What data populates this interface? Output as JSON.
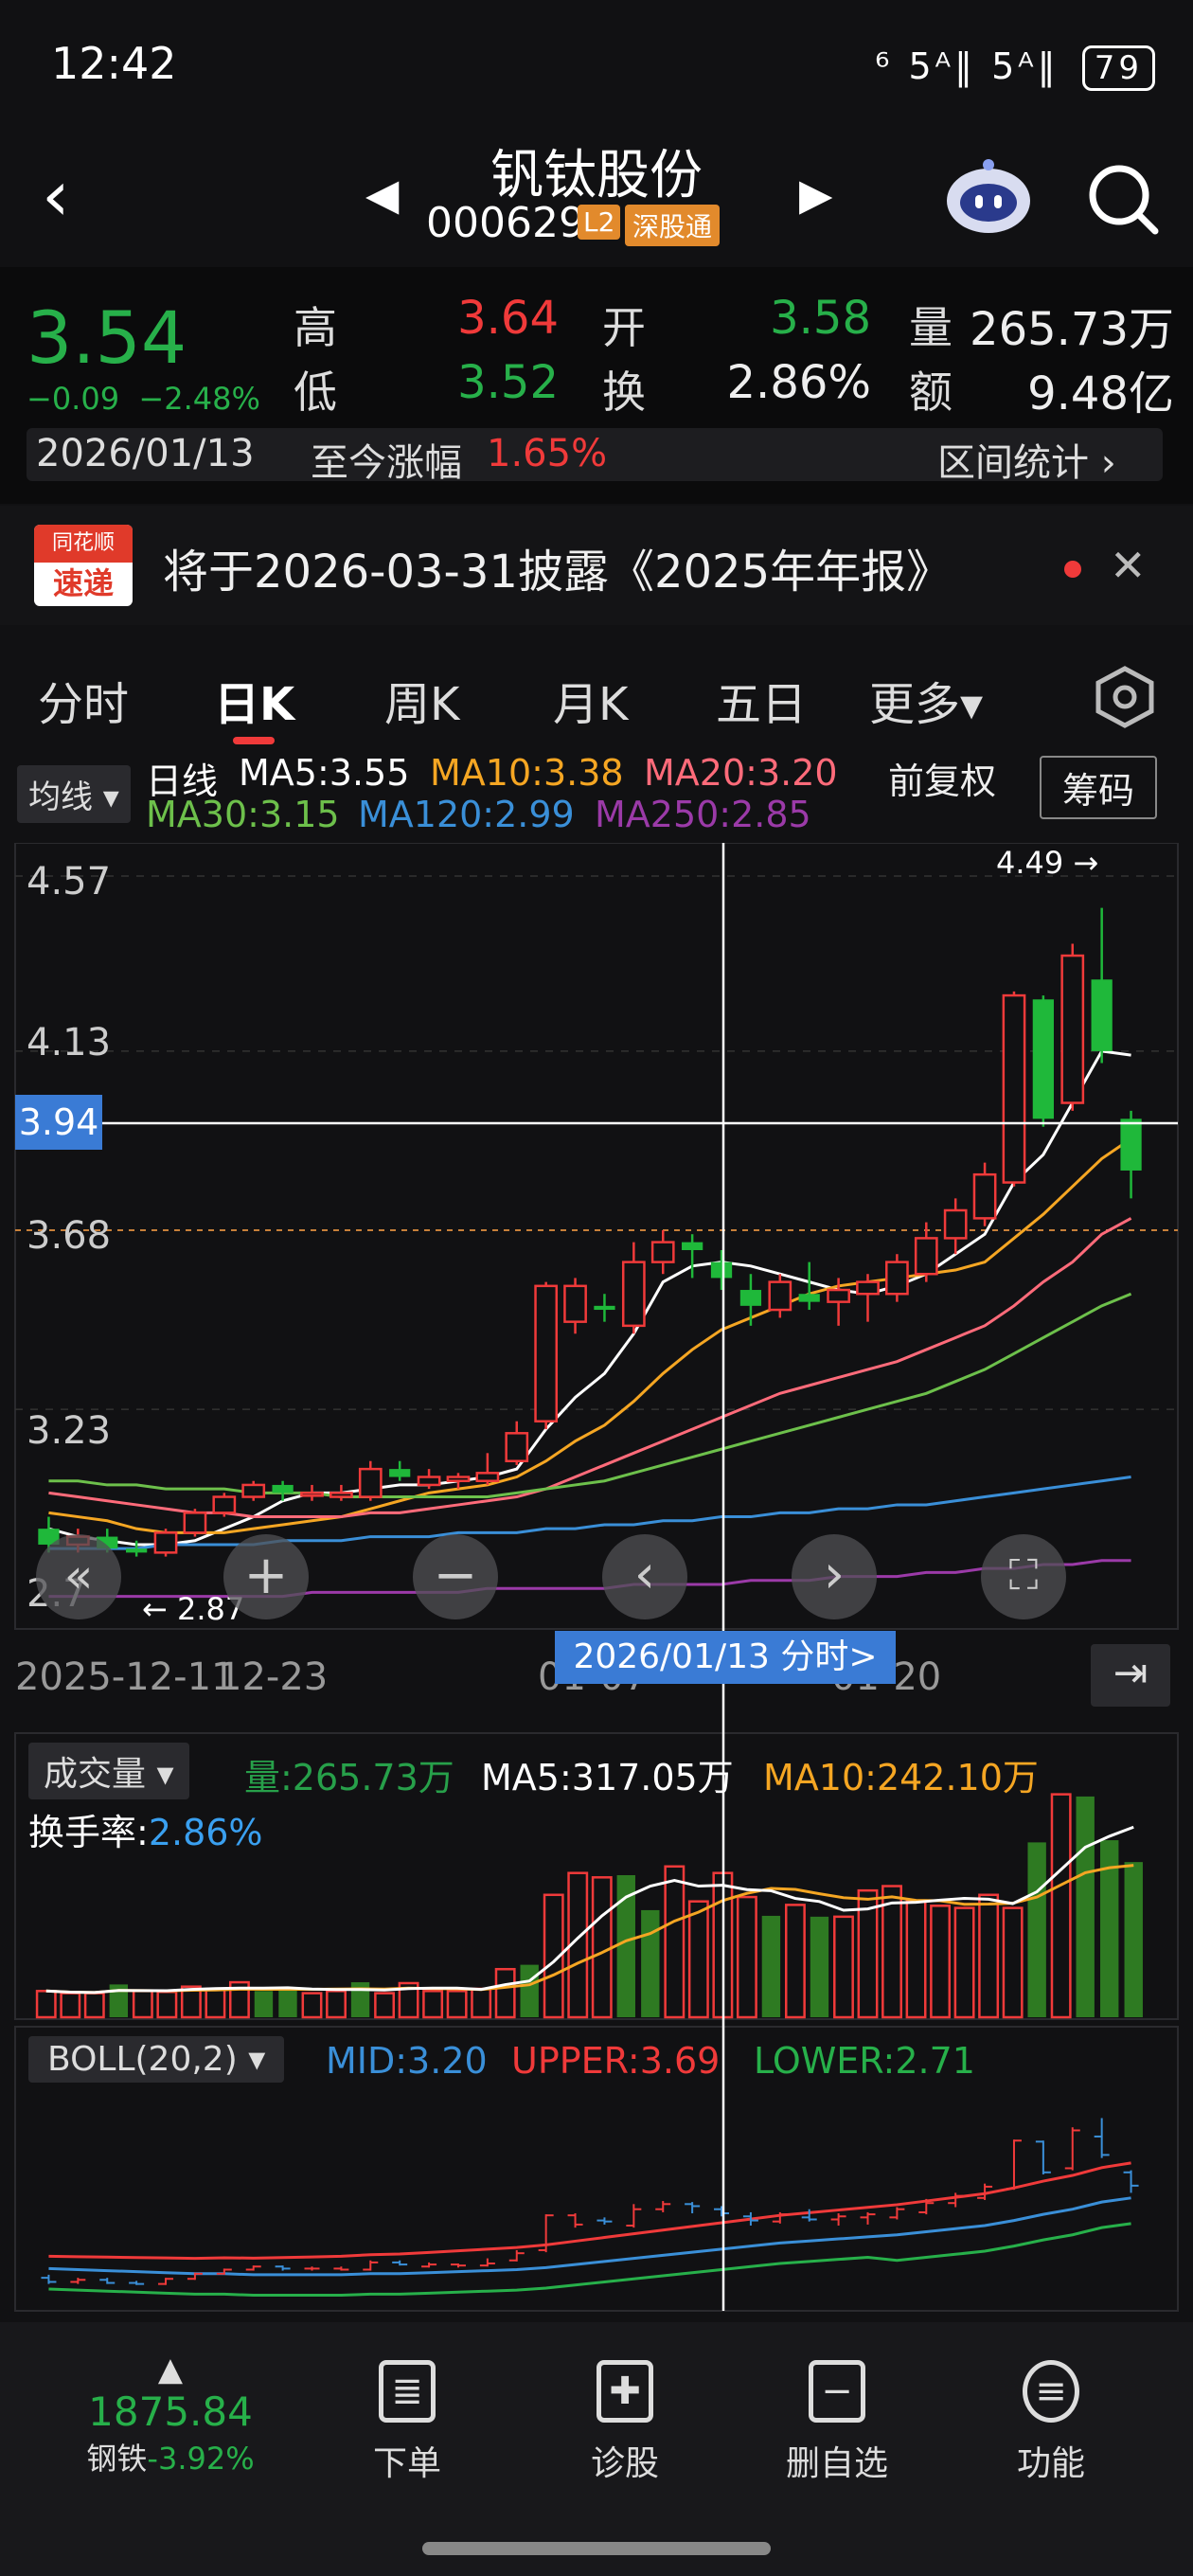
{
  "status": {
    "time": "12:42",
    "signal": "⁶ 5ᴬ‖ 5ᴬ‖",
    "battery": "79"
  },
  "header": {
    "name": "钒钛股份",
    "code": "000629",
    "tag_l2": "L2",
    "tag_connect": "深股通"
  },
  "quote": {
    "price": "3.54",
    "change": "−0.09",
    "change_pct": "−2.48%",
    "high_label": "高",
    "high": "3.64",
    "low_label": "低",
    "low": "3.52",
    "open_label": "开",
    "open": "3.58",
    "turnover_label": "换",
    "turnover": "2.86%",
    "vol_label": "量",
    "volume": "265.73万",
    "amt_label": "额",
    "amount": "9.48亿",
    "date": "2026/01/13",
    "since_label": "至今涨幅",
    "since_pct": "1.65%",
    "range_label": "区间统计"
  },
  "news": {
    "logo_top": "同花顺",
    "logo_bottom": "速递",
    "text": "将于2026-03-31披露《2025年年报》"
  },
  "tabs": [
    {
      "label": "分时"
    },
    {
      "label": "日K"
    },
    {
      "label": "周K"
    },
    {
      "label": "月K"
    },
    {
      "label": "五日"
    },
    {
      "label": "更多▾"
    }
  ],
  "ma": {
    "dropdown": "均线 ▾",
    "prefix": "日线",
    "ma5": "MA5:3.55",
    "ma10": "MA10:3.38",
    "ma20": "MA20:3.20",
    "ma30": "MA30:3.15",
    "ma120": "MA120:2.99",
    "ma250": "MA250:2.85",
    "adjust": "前复权",
    "chip": "筹码"
  },
  "chart_data": {
    "type": "candlestick",
    "y_ticks": [
      "4.57",
      "4.13",
      "3.68",
      "3.23",
      "2.7"
    ],
    "cursor_price": "3.94",
    "max_label": "4.49 →",
    "min_label": "← 2.87",
    "x_labels": [
      "2025-12-11",
      "12-23",
      "01-07",
      "01-20"
    ],
    "cursor_date": "2026/01/13 分时>",
    "candles": [
      {
        "o": 2.93,
        "c": 2.89,
        "h": 2.96,
        "l": 2.87,
        "up": false
      },
      {
        "o": 2.89,
        "c": 2.91,
        "h": 2.93,
        "l": 2.87,
        "up": true
      },
      {
        "o": 2.91,
        "c": 2.88,
        "h": 2.93,
        "l": 2.87,
        "up": false
      },
      {
        "o": 2.88,
        "c": 2.87,
        "h": 2.9,
        "l": 2.86,
        "up": false
      },
      {
        "o": 2.87,
        "c": 2.92,
        "h": 2.93,
        "l": 2.86,
        "up": true
      },
      {
        "o": 2.92,
        "c": 2.97,
        "h": 2.98,
        "l": 2.91,
        "up": true
      },
      {
        "o": 2.97,
        "c": 3.01,
        "h": 3.02,
        "l": 2.96,
        "up": true
      },
      {
        "o": 3.01,
        "c": 3.04,
        "h": 3.05,
        "l": 3.0,
        "up": true
      },
      {
        "o": 3.04,
        "c": 3.02,
        "h": 3.05,
        "l": 3.0,
        "up": false
      },
      {
        "o": 3.02,
        "c": 3.02,
        "h": 3.04,
        "l": 3.0,
        "up": true
      },
      {
        "o": 3.02,
        "c": 3.01,
        "h": 3.04,
        "l": 3.0,
        "up": true
      },
      {
        "o": 3.01,
        "c": 3.08,
        "h": 3.1,
        "l": 3.0,
        "up": true
      },
      {
        "o": 3.08,
        "c": 3.06,
        "h": 3.1,
        "l": 3.05,
        "up": false
      },
      {
        "o": 3.04,
        "c": 3.06,
        "h": 3.08,
        "l": 3.03,
        "up": true
      },
      {
        "o": 3.06,
        "c": 3.05,
        "h": 3.07,
        "l": 3.03,
        "up": true
      },
      {
        "o": 3.05,
        "c": 3.07,
        "h": 3.12,
        "l": 3.04,
        "up": true
      },
      {
        "o": 3.1,
        "c": 3.17,
        "h": 3.2,
        "l": 3.09,
        "up": true
      },
      {
        "o": 3.2,
        "c": 3.54,
        "h": 3.55,
        "l": 3.18,
        "up": true
      },
      {
        "o": 3.54,
        "c": 3.45,
        "h": 3.56,
        "l": 3.42,
        "up": true
      },
      {
        "o": 3.49,
        "c": 3.48,
        "h": 3.52,
        "l": 3.45,
        "up": false
      },
      {
        "o": 3.44,
        "c": 3.6,
        "h": 3.65,
        "l": 3.42,
        "up": true
      },
      {
        "o": 3.6,
        "c": 3.65,
        "h": 3.68,
        "l": 3.57,
        "up": true
      },
      {
        "o": 3.65,
        "c": 3.63,
        "h": 3.67,
        "l": 3.56,
        "up": false
      },
      {
        "o": 3.6,
        "c": 3.56,
        "h": 3.63,
        "l": 3.53,
        "up": false
      },
      {
        "o": 3.53,
        "c": 3.49,
        "h": 3.57,
        "l": 3.44,
        "up": false
      },
      {
        "o": 3.48,
        "c": 3.55,
        "h": 3.57,
        "l": 3.46,
        "up": true
      },
      {
        "o": 3.52,
        "c": 3.5,
        "h": 3.6,
        "l": 3.48,
        "up": false
      },
      {
        "o": 3.5,
        "c": 3.53,
        "h": 3.56,
        "l": 3.44,
        "up": true
      },
      {
        "o": 3.52,
        "c": 3.55,
        "h": 3.57,
        "l": 3.45,
        "up": true
      },
      {
        "o": 3.52,
        "c": 3.6,
        "h": 3.62,
        "l": 3.5,
        "up": true
      },
      {
        "o": 3.57,
        "c": 3.66,
        "h": 3.7,
        "l": 3.55,
        "up": true
      },
      {
        "o": 3.66,
        "c": 3.73,
        "h": 3.76,
        "l": 3.62,
        "up": true
      },
      {
        "o": 3.71,
        "c": 3.82,
        "h": 3.85,
        "l": 3.69,
        "up": true
      },
      {
        "o": 3.8,
        "c": 4.27,
        "h": 4.28,
        "l": 3.79,
        "up": true
      },
      {
        "o": 4.26,
        "c": 3.96,
        "h": 4.27,
        "l": 3.94,
        "up": false
      },
      {
        "o": 4.0,
        "c": 4.37,
        "h": 4.4,
        "l": 3.98,
        "up": true
      },
      {
        "o": 4.31,
        "c": 4.13,
        "h": 4.49,
        "l": 4.1,
        "up": false
      },
      {
        "o": 3.96,
        "c": 3.83,
        "h": 3.98,
        "l": 3.76,
        "up": false
      }
    ],
    "ma_series": [
      {
        "name": "MA5",
        "color": "#ffffff",
        "values": [
          2.93,
          2.91,
          2.9,
          2.89,
          2.89,
          2.9,
          2.93,
          2.96,
          3.0,
          3.02,
          3.02,
          3.03,
          3.04,
          3.04,
          3.05,
          3.06,
          3.08,
          3.18,
          3.26,
          3.32,
          3.42,
          3.55,
          3.59,
          3.6,
          3.59,
          3.57,
          3.55,
          3.53,
          3.52,
          3.54,
          3.57,
          3.62,
          3.67,
          3.8,
          3.87,
          4.0,
          4.13,
          4.12
        ]
      },
      {
        "name": "MA10",
        "color": "#f5a623",
        "values": [
          2.97,
          2.96,
          2.95,
          2.93,
          2.92,
          2.92,
          2.92,
          2.93,
          2.94,
          2.95,
          2.96,
          2.98,
          3.0,
          3.02,
          3.03,
          3.04,
          3.06,
          3.1,
          3.15,
          3.19,
          3.25,
          3.32,
          3.38,
          3.43,
          3.46,
          3.49,
          3.52,
          3.54,
          3.55,
          3.56,
          3.57,
          3.58,
          3.6,
          3.66,
          3.72,
          3.79,
          3.86,
          3.91
        ]
      },
      {
        "name": "MA20",
        "color": "#ff6b7a",
        "values": [
          3.02,
          3.01,
          3.0,
          2.99,
          2.98,
          2.97,
          2.97,
          2.96,
          2.96,
          2.96,
          2.96,
          2.97,
          2.97,
          2.98,
          2.99,
          3.0,
          3.01,
          3.03,
          3.06,
          3.09,
          3.12,
          3.15,
          3.18,
          3.21,
          3.24,
          3.27,
          3.29,
          3.31,
          3.33,
          3.35,
          3.38,
          3.41,
          3.44,
          3.49,
          3.55,
          3.6,
          3.67,
          3.71
        ]
      },
      {
        "name": "MA30",
        "color": "#6dc04b",
        "values": [
          3.05,
          3.05,
          3.04,
          3.04,
          3.03,
          3.03,
          3.03,
          3.02,
          3.02,
          3.02,
          3.01,
          3.01,
          3.01,
          3.01,
          3.01,
          3.01,
          3.02,
          3.03,
          3.04,
          3.05,
          3.07,
          3.09,
          3.11,
          3.13,
          3.15,
          3.17,
          3.19,
          3.21,
          3.23,
          3.25,
          3.27,
          3.3,
          3.33,
          3.37,
          3.41,
          3.45,
          3.49,
          3.52
        ]
      },
      {
        "name": "MA120",
        "color": "#3a8fd8",
        "values": [
          2.88,
          2.88,
          2.88,
          2.88,
          2.89,
          2.89,
          2.89,
          2.89,
          2.9,
          2.9,
          2.9,
          2.91,
          2.91,
          2.91,
          2.92,
          2.92,
          2.92,
          2.93,
          2.93,
          2.94,
          2.94,
          2.95,
          2.95,
          2.96,
          2.96,
          2.97,
          2.97,
          2.98,
          2.98,
          2.99,
          2.99,
          3.0,
          3.01,
          3.02,
          3.03,
          3.04,
          3.05,
          3.06
        ]
      },
      {
        "name": "MA250",
        "color": "#9b3aa8",
        "values": [
          2.76,
          2.76,
          2.76,
          2.76,
          2.76,
          2.76,
          2.76,
          2.76,
          2.76,
          2.77,
          2.77,
          2.77,
          2.77,
          2.77,
          2.77,
          2.78,
          2.78,
          2.78,
          2.78,
          2.78,
          2.79,
          2.79,
          2.79,
          2.79,
          2.8,
          2.8,
          2.8,
          2.81,
          2.81,
          2.81,
          2.82,
          2.82,
          2.83,
          2.83,
          2.84,
          2.84,
          2.85,
          2.85
        ]
      }
    ],
    "volume": {
      "dropdown": "成交量 ▾",
      "vol_label": "量:265.73万",
      "ma5_label": "MA5:317.05万",
      "ma10_label": "MA10:242.10万",
      "turnover_label": "换手率:",
      "turnover_value": "2.86%",
      "values": [
        60,
        55,
        55,
        75,
        60,
        58,
        70,
        65,
        80,
        60,
        62,
        55,
        60,
        80,
        55,
        78,
        60,
        60,
        65,
        110,
        120,
        280,
        330,
        320,
        325,
        245,
        345,
        265,
        330,
        275,
        232,
        257,
        230,
        230,
        290,
        300,
        265,
        255,
        250,
        280,
        250,
        400,
        510,
        505,
        405,
        355
      ],
      "up": [
        true,
        true,
        true,
        false,
        true,
        true,
        true,
        true,
        true,
        false,
        false,
        true,
        true,
        false,
        true,
        true,
        true,
        true,
        true,
        true,
        false,
        true,
        true,
        true,
        false,
        false,
        true,
        true,
        true,
        true,
        false,
        true,
        false,
        true,
        true,
        true,
        true,
        true,
        true,
        true,
        true,
        false,
        true,
        false,
        false,
        false
      ]
    },
    "boll": {
      "dropdown": "BOLL(20,2) ▾",
      "mid": "MID:3.20",
      "upper": "UPPER:3.69",
      "lower": "LOWER:2.71"
    }
  },
  "bottom": {
    "index_value": "1875.84",
    "index_name": "钢铁",
    "index_change": "-3.92%",
    "items": [
      {
        "label": "下单",
        "icon": "≣"
      },
      {
        "label": "诊股",
        "icon": "✚"
      },
      {
        "label": "删自选",
        "icon": "−"
      },
      {
        "label": "功能",
        "icon": "≡"
      }
    ]
  }
}
